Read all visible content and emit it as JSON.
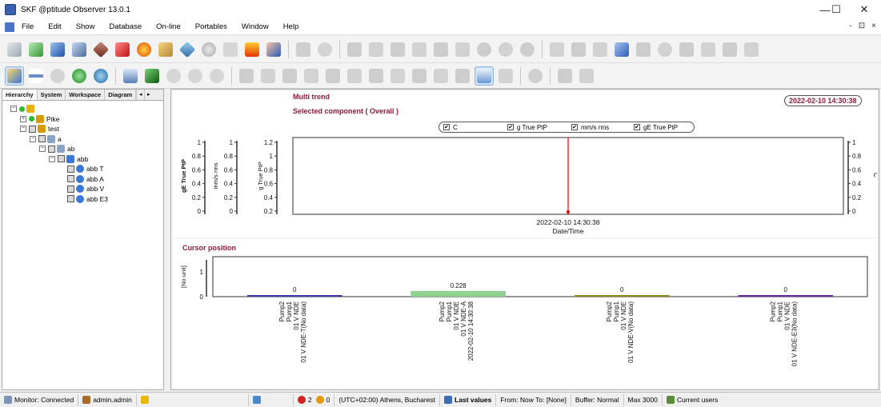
{
  "window": {
    "title": "SKF @ptitude Observer 13.0.1",
    "controls": [
      "—",
      "☐",
      "✕"
    ]
  },
  "menu": {
    "items": [
      "File",
      "Edit",
      "Show",
      "Database",
      "On-line",
      "Portables",
      "Window",
      "Help"
    ],
    "right_controls": [
      "-",
      "⊡",
      "×"
    ]
  },
  "left_panel": {
    "tabs": [
      "Hierarchy",
      "System",
      "Workspace",
      "Diagram"
    ],
    "tab_nav": [
      "◂",
      "▸"
    ],
    "tree": [
      {
        "label": "",
        "depth": 0,
        "expander": "−",
        "icon_color": "#e9b100"
      },
      {
        "label": "Pike",
        "depth": 1,
        "expander": "+",
        "icon_color": "#d89b00"
      },
      {
        "label": "test",
        "depth": 1,
        "expander": "−",
        "icon_color": "#d89b00"
      },
      {
        "label": "a",
        "depth": 2,
        "expander": "−",
        "icon_color": "#8aa4c8"
      },
      {
        "label": "ab",
        "depth": 3,
        "expander": "−",
        "icon_color": "#8aa4c8"
      },
      {
        "label": "abb",
        "depth": 4,
        "expander": "−",
        "icon_color": "#3a78d6"
      },
      {
        "label": "abb T",
        "depth": 5,
        "expander": "",
        "icon_color": "#3a78d6"
      },
      {
        "label": "abb A",
        "depth": 5,
        "expander": "",
        "icon_color": "#3a78d6"
      },
      {
        "label": "abb V",
        "depth": 5,
        "expander": "",
        "icon_color": "#3a78d6"
      },
      {
        "label": "abb E3",
        "depth": 5,
        "expander": "",
        "icon_color": "#3a78d6"
      }
    ]
  },
  "multi_trend": {
    "title": "Multi trend",
    "subtitle": "Selected component ( Overall )",
    "cursor_date": "2022-02-10 14:30:38",
    "legend": [
      "C",
      "g True PtP",
      "mm/s rms",
      "gE True PtP"
    ],
    "chart_data": {
      "type": "line",
      "x_label": "Date/Time",
      "x_tick": "2022-02-10 14:30:38",
      "left_axes": [
        {
          "label": "gE True PtP",
          "ticks": [
            "1",
            "0.8",
            "0.6",
            "0.4",
            "0.2",
            "0"
          ]
        },
        {
          "label": "mm/s rms",
          "ticks": [
            "1",
            "0.8",
            "0.6",
            "0.4",
            "0.2",
            "0"
          ]
        },
        {
          "label": "g True PtP",
          "ticks": [
            "1.2",
            "1",
            "0.8",
            "0.6",
            "0.4",
            "0.2"
          ]
        }
      ],
      "right_axis": {
        "label": "C",
        "ticks": [
          "1",
          "0.8",
          "0.6",
          "0.4",
          "0.2",
          "0"
        ]
      },
      "cursor_color": "#e00000"
    }
  },
  "cursor_position": {
    "title": "Cursor position",
    "chart_data": {
      "type": "bar",
      "ylabel": "[No unit]",
      "yticks": [
        "1",
        "0"
      ],
      "ylim": [
        0,
        1.6
      ],
      "series": [
        {
          "name": "Pump2 Pump1 01 V NDE 01 V NDE-T(No data)",
          "value": 0,
          "value_label": "0",
          "color": "#3a3aa8",
          "labels": [
            "Pump2",
            "Pump1",
            "01 V NDE",
            "01 V NDE-T(No data)"
          ]
        },
        {
          "name": "Pump2 Pump1 01 V NDE 01 V NDE-A 2022-02-10 14:30:38",
          "value": 0.228,
          "value_label": "0.228",
          "color": "#8fd18f",
          "labels": [
            "Pump2",
            "Pump1",
            "01 V NDE",
            "01 V NDE-A",
            "2022-02-10 14:30:38"
          ]
        },
        {
          "name": "Pump2 Pump1 01 V NDE 01 V NDE-V(No data)",
          "value": 0,
          "value_label": "0",
          "color": "#8a8a20",
          "labels": [
            "Pump2",
            "Pump1",
            "01 V NDE",
            "01 V NDE-V(No data)"
          ]
        },
        {
          "name": "Pump2 Pump1 01 V NDE 01 V NDE-E3(No data)",
          "value": 0,
          "value_label": "0",
          "color": "#6a2a9a",
          "labels": [
            "Pump2",
            "Pump1",
            "01 V NDE",
            "01 V NDE-E3(No data)"
          ]
        }
      ]
    }
  },
  "status_bar": {
    "monitor": "Monitor: Connected",
    "user": "admin.admin",
    "alarm_count_a": "2",
    "alarm_count_b": "0",
    "timezone": "(UTC+02:00) Athens, Bucharest",
    "last_values": "Last values",
    "from_to": "From: Now To: [None]",
    "buffer": "Buffer: Normal",
    "max": "Max 3000",
    "current_users": "Current users"
  },
  "colors": {
    "accent_title": "#8a1a3a",
    "cursor": "#e00000",
    "panel_border": "#a9a9a9"
  },
  "toolbar_icons": {
    "row1": [
      "copy-icon",
      "check-icon",
      "edit-icon",
      "monitor-icon",
      "diamond-icon",
      "alarm-red-icon",
      "bell-icon",
      "box-icon",
      "network-icon",
      "gear-icon",
      "sheet-icon",
      "fire-icon",
      "hand-info-icon",
      "disabled-icon"
    ],
    "row2": [
      "hierarchy-icon",
      "bar-icon",
      "link-icon",
      "refresh-green-icon",
      "refresh-blue-icon",
      "drawer-icon",
      "sync-icon",
      "timer-icon",
      "grid-icon",
      "multitrend-icon",
      "close-icon",
      "print-icon"
    ]
  }
}
